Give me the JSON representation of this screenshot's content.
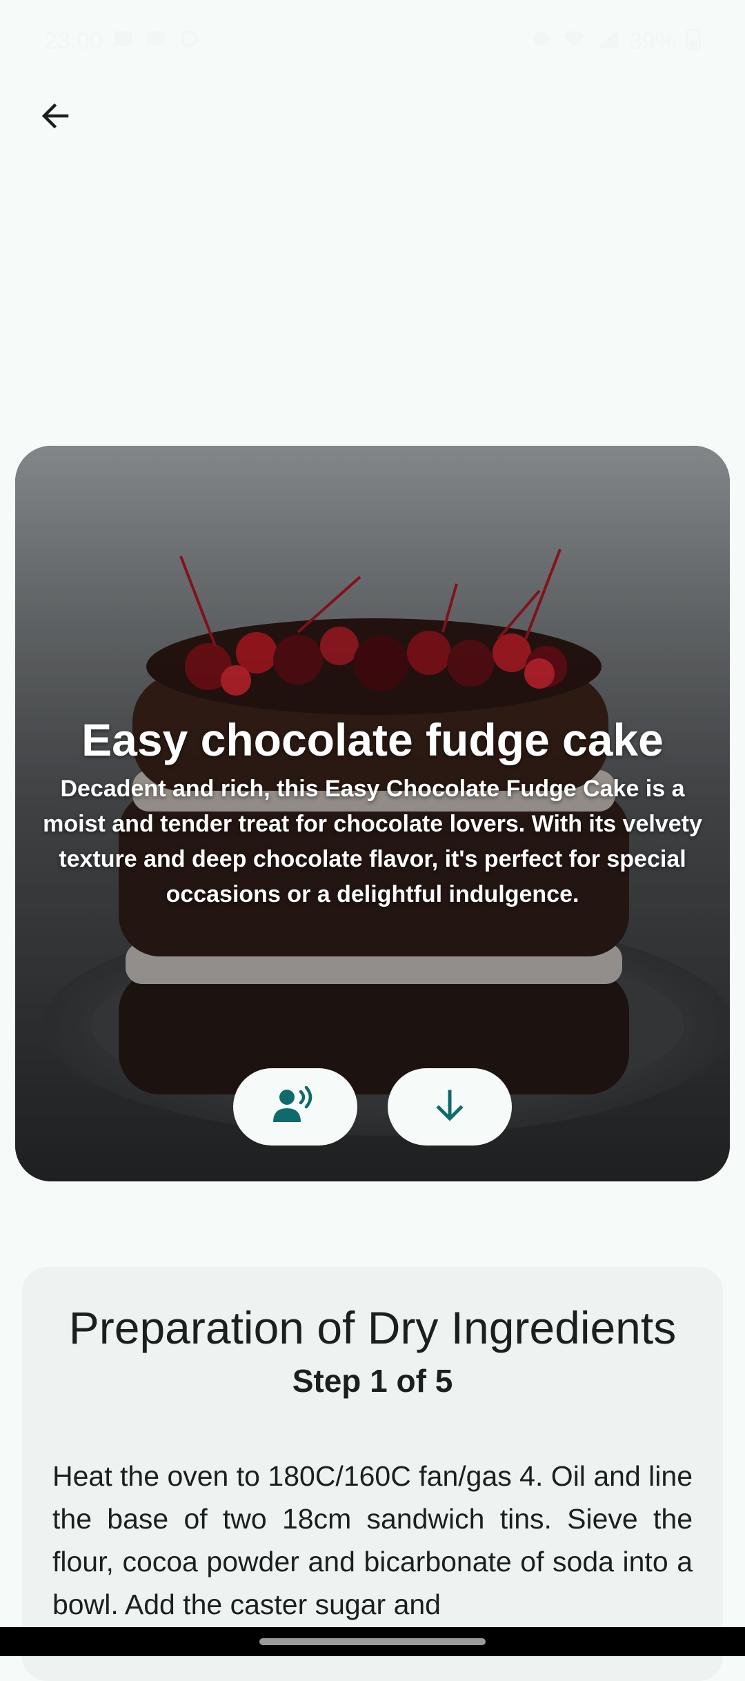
{
  "status_bar": {
    "time": "23:00",
    "battery": "39%"
  },
  "colors": {
    "accent": "#0f6b6b",
    "background": "#f6faf9",
    "card": "#eef2f0"
  },
  "icons": {
    "back": "arrow-left-icon",
    "voice": "record-voice-over-icon",
    "download": "arrow-down-icon"
  },
  "recipe": {
    "title": "Easy chocolate fudge cake",
    "description": "Decadent and rich, this Easy Chocolate Fudge Cake is a moist and tender treat for chocolate lovers. With its velvety texture and deep chocolate flavor, it's perfect for special occasions or a delightful indulgence."
  },
  "step": {
    "title": "Preparation of Dry Ingredients",
    "counter": "Step 1 of 5",
    "body": "Heat the oven to 180C/160C fan/gas 4. Oil and line the base of two 18cm sandwich tins. Sieve the flour, cocoa powder and bicarbonate of soda into a bowl. Add the caster sugar and"
  }
}
